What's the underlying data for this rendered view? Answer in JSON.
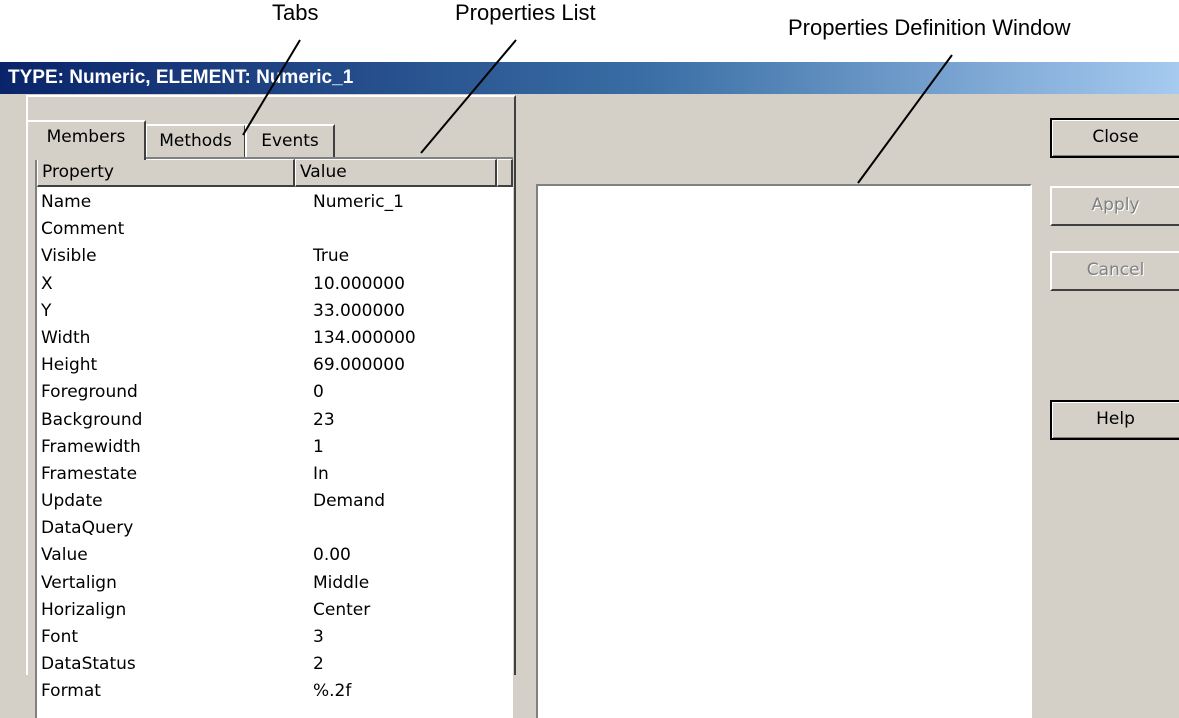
{
  "callouts": {
    "tabs": "Tabs",
    "properties_list": "Properties List",
    "properties_definition_window": "Properties Definition Window"
  },
  "window": {
    "title": "TYPE: Numeric,  ELEMENT: Numeric_1",
    "title_bar_color": "#0a246a"
  },
  "tabs": [
    {
      "label": "Members",
      "active": true
    },
    {
      "label": "Methods",
      "active": false
    },
    {
      "label": "Events",
      "active": false
    }
  ],
  "properties": {
    "columns": {
      "property": "Property",
      "value": "Value"
    },
    "rows": [
      {
        "name": "Name",
        "value": "Numeric_1"
      },
      {
        "name": "Comment",
        "value": ""
      },
      {
        "name": "Visible",
        "value": "True"
      },
      {
        "name": "X",
        "value": "10.000000"
      },
      {
        "name": "Y",
        "value": "33.000000"
      },
      {
        "name": "Width",
        "value": "134.000000"
      },
      {
        "name": "Height",
        "value": "69.000000"
      },
      {
        "name": "Foreground",
        "value": "0"
      },
      {
        "name": "Background",
        "value": "23"
      },
      {
        "name": "Framewidth",
        "value": "1"
      },
      {
        "name": "Framestate",
        "value": "In"
      },
      {
        "name": "Update",
        "value": "Demand"
      },
      {
        "name": "DataQuery",
        "value": ""
      },
      {
        "name": "Value",
        "value": "0.00"
      },
      {
        "name": "Vertalign",
        "value": "Middle"
      },
      {
        "name": "Horizalign",
        "value": "Center"
      },
      {
        "name": "Font",
        "value": "3"
      },
      {
        "name": "DataStatus",
        "value": "2"
      },
      {
        "name": "Format",
        "value": "%.2f"
      }
    ]
  },
  "buttons": {
    "close": {
      "label": "Close",
      "enabled": true
    },
    "apply": {
      "label": "Apply",
      "enabled": false
    },
    "cancel": {
      "label": "Cancel",
      "enabled": false
    },
    "help": {
      "label": "Help",
      "enabled": true
    }
  }
}
